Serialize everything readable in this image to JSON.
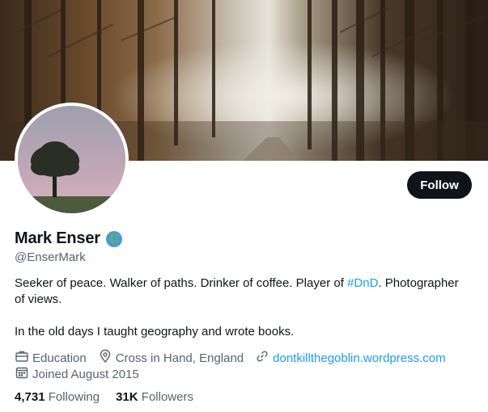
{
  "profile": {
    "display_name": "Mark Enser",
    "handle": "@EnserMark",
    "follow_label": "Follow",
    "bio_line1_a": "Seeker of peace. Walker of paths. Drinker of coffee. Player of ",
    "bio_hashtag": "#DnD",
    "bio_line1_b": ". Photographer of views.",
    "bio_line2": "In the old days I taught geography and wrote books.",
    "category": "Education",
    "location": "Cross in Hand, England",
    "website": "dontkillthegoblin.wordpress.com",
    "joined": "Joined August 2015",
    "following_count": "4,731",
    "following_label": "Following",
    "followers_count": "31K",
    "followers_label": "Followers",
    "emoji": "globe-icon"
  },
  "colors": {
    "accent": "#1d9bf0",
    "follow_bg": "#0f1419",
    "secondary_text": "#536471"
  }
}
